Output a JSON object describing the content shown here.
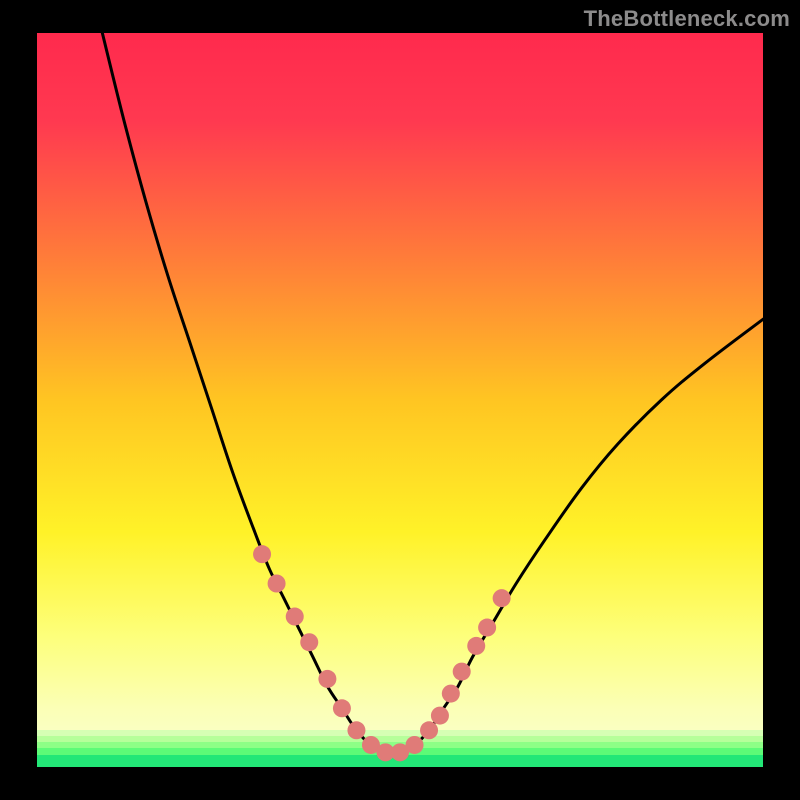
{
  "watermark": "TheBottleneck.com",
  "colors": {
    "curve_stroke": "#000000",
    "marker_fill": "#e07b78",
    "marker_stroke": "#c96a66",
    "gradient_top": "#ff2a4d",
    "gradient_mid": "#ffd11a",
    "gradient_bottom": "#23e777"
  },
  "chart_data": {
    "type": "line",
    "title": "",
    "xlabel": "",
    "ylabel": "",
    "xlim": [
      0,
      100
    ],
    "ylim": [
      0,
      100
    ],
    "grid": false,
    "legend": false,
    "description": "V-shaped bottleneck curve over vertical red-to-green gradient. The curve descends steeply from top-left, flattens near the bottom around x≈45-52, then rises with diminishing slope toward the right. Coral dot markers cluster along the lower portion of both arms and along the flat trough.",
    "series": [
      {
        "name": "bottleneck-curve",
        "x": [
          9,
          12,
          15,
          18,
          21,
          24,
          27,
          30,
          32,
          34,
          36,
          38,
          40,
          42,
          44,
          46,
          48,
          50,
          52,
          54,
          56,
          58,
          60,
          63,
          66,
          70,
          75,
          80,
          86,
          92,
          100
        ],
        "y": [
          100,
          88,
          77,
          67,
          58,
          49,
          40,
          32,
          27,
          23,
          19,
          15,
          11,
          8,
          5,
          3,
          2,
          2,
          3,
          5,
          8,
          11,
          15,
          20,
          25,
          31,
          38,
          44,
          50,
          55,
          61
        ]
      }
    ],
    "markers": {
      "x": [
        31,
        33,
        35.5,
        37.5,
        40,
        42,
        44,
        46,
        48,
        50,
        52,
        54,
        55.5,
        57,
        58.5,
        60.5,
        62,
        64
      ],
      "y": [
        29,
        25,
        20.5,
        17,
        12,
        8,
        5,
        3,
        2,
        2,
        3,
        5,
        7,
        10,
        13,
        16.5,
        19,
        23
      ]
    }
  }
}
